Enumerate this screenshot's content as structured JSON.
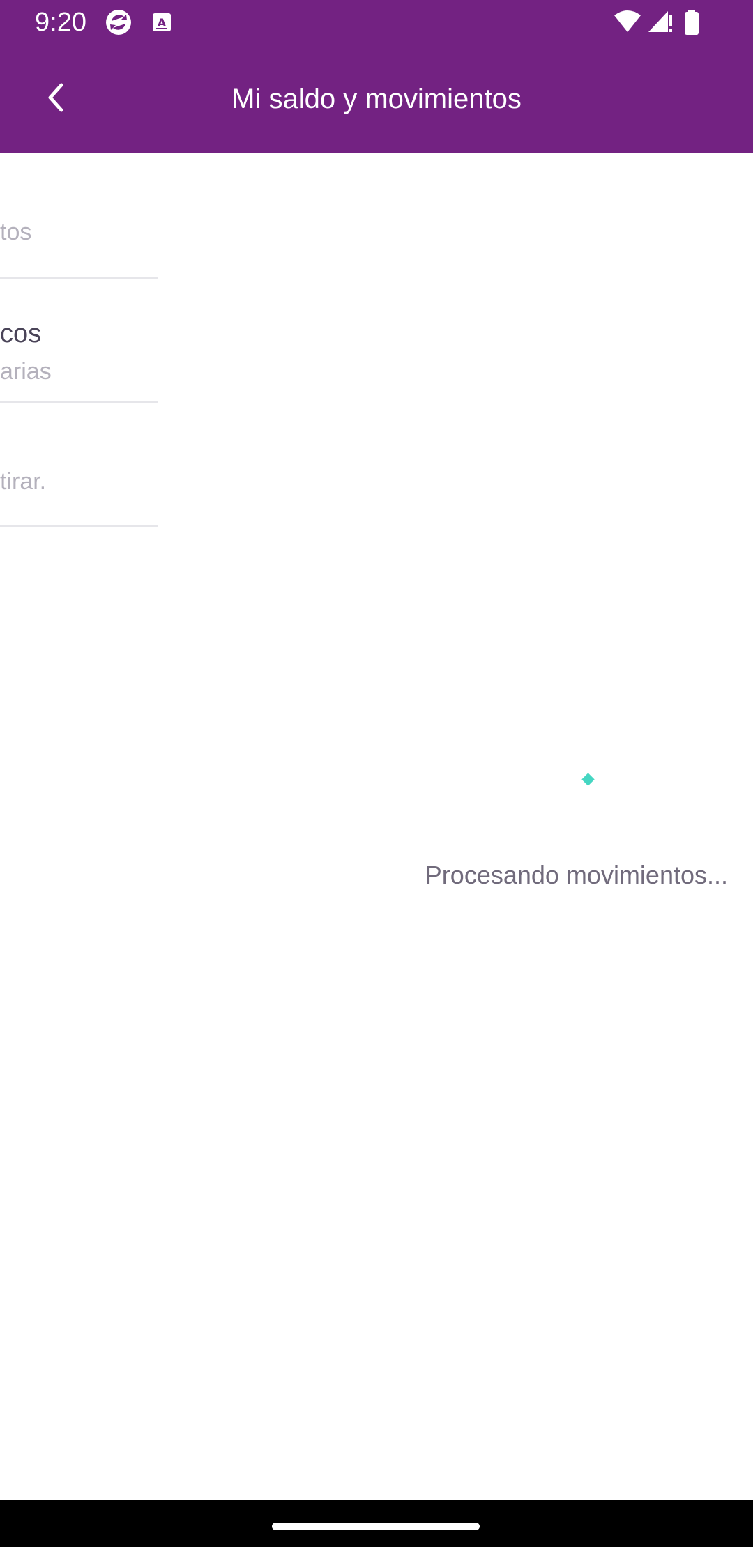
{
  "status_bar": {
    "time": "9:20",
    "icons_left": [
      "sync-app-icon",
      "text-a-icon"
    ],
    "icons_right": [
      "wifi-icon",
      "cell-signal-icon",
      "battery-icon"
    ],
    "background": "#732282"
  },
  "app_bar": {
    "title": "Mi saldo y movimientos",
    "back_icon": "chevron-left-icon",
    "background": "#732282"
  },
  "slide_list": {
    "items": [
      {
        "title": "",
        "subtitle": "tos"
      },
      {
        "title": "cos",
        "subtitle": "arias"
      },
      {
        "title": "",
        "subtitle": "tirar."
      }
    ]
  },
  "loading": {
    "text": "Procesando movimientos...",
    "spinner_color": "#45d6c2"
  },
  "nav_bar": {
    "handle": "home-gesture-handle"
  }
}
